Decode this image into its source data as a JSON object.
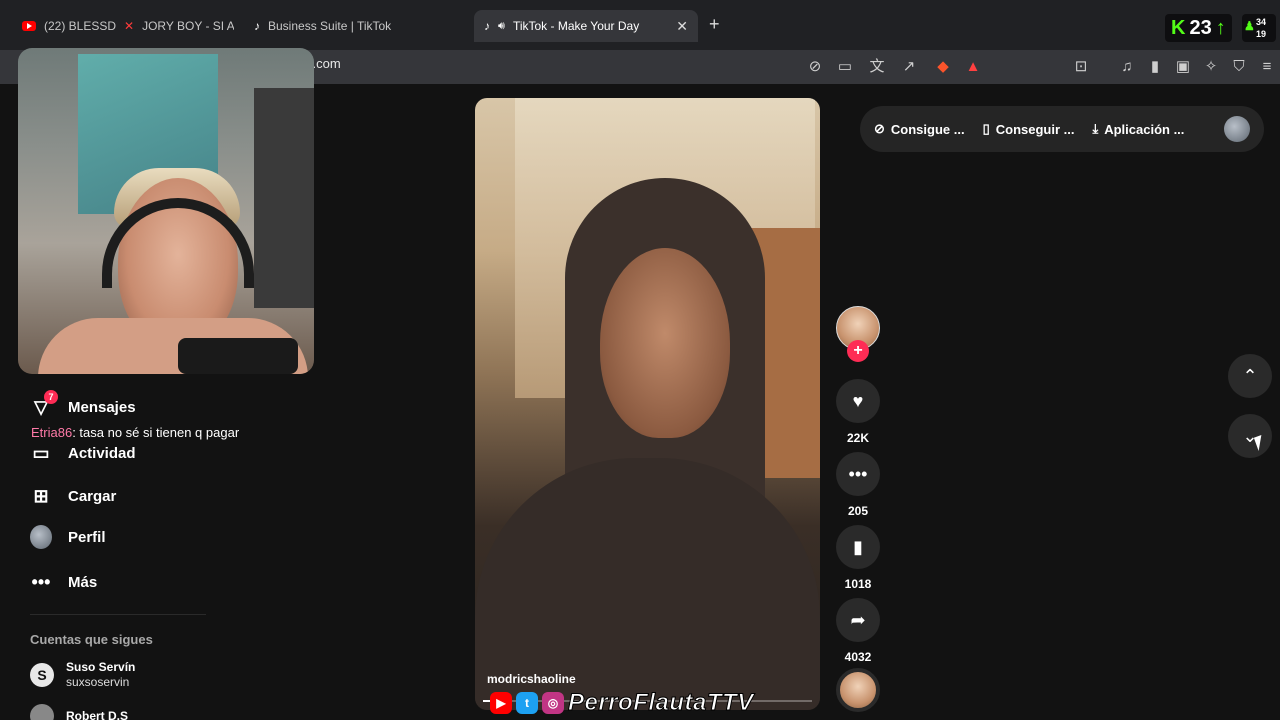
{
  "browser": {
    "tabs": [
      {
        "label": "(22) BLESSD",
        "extra": "JORY BOY - SI A BUE"
      },
      {
        "label": "Business Suite | TikTok"
      },
      {
        "label": "TikTok - Make Your Day"
      }
    ],
    "url": "k.com",
    "kick_count": "23",
    "viewers_top": "34",
    "viewers_bottom": "19"
  },
  "sidebar": {
    "items": [
      {
        "label": "Mensajes",
        "badge": "7",
        "icon": "send-icon"
      },
      {
        "label": "Actividad",
        "icon": "chat-bubble-icon"
      },
      {
        "label": "Cargar",
        "icon": "plus-square-icon"
      },
      {
        "label": "Perfil",
        "icon": "avatar"
      },
      {
        "label": "Más",
        "icon": "more-icon"
      }
    ],
    "chat": {
      "user": "Etria86",
      "message": ": tasa no sé si tienen q pagar"
    },
    "following_label": "Cuentas que sigues",
    "following": [
      {
        "name": "Suso Servín",
        "handle": "suxsoservin",
        "initial": "S"
      },
      {
        "name": "Robert D.S",
        "handle": ""
      }
    ]
  },
  "video": {
    "author": "modricshaoline",
    "progress": 0.02,
    "streamer_name": "PerroFlautaTTV"
  },
  "actions": {
    "likes": "22K",
    "comments": "205",
    "saves": "1018",
    "shares": "4032"
  },
  "top_bar": {
    "items": [
      "Consigue ...",
      "Conseguir ...",
      "Aplicación ..."
    ]
  }
}
